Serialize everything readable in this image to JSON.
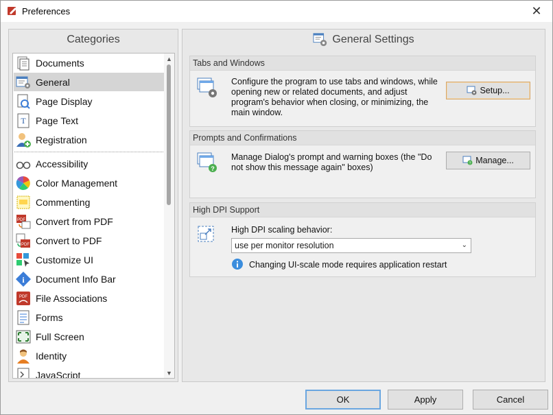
{
  "window": {
    "title": "Preferences",
    "close_glyph": "✕"
  },
  "left": {
    "header": "Categories",
    "items": [
      {
        "label": "Documents",
        "icon": "documents-icon"
      },
      {
        "label": "General",
        "icon": "general-icon",
        "selected": true
      },
      {
        "label": "Page Display",
        "icon": "page-display-icon"
      },
      {
        "label": "Page Text",
        "icon": "page-text-icon"
      },
      {
        "label": "Registration",
        "icon": "registration-icon"
      },
      {
        "label": "Accessibility",
        "icon": "accessibility-icon"
      },
      {
        "label": "Color Management",
        "icon": "color-management-icon"
      },
      {
        "label": "Commenting",
        "icon": "commenting-icon"
      },
      {
        "label": "Convert from PDF",
        "icon": "convert-from-pdf-icon"
      },
      {
        "label": "Convert to PDF",
        "icon": "convert-to-pdf-icon"
      },
      {
        "label": "Customize UI",
        "icon": "customize-ui-icon"
      },
      {
        "label": "Document Info Bar",
        "icon": "document-info-bar-icon"
      },
      {
        "label": "File Associations",
        "icon": "file-associations-icon"
      },
      {
        "label": "Forms",
        "icon": "forms-icon"
      },
      {
        "label": "Full Screen",
        "icon": "full-screen-icon"
      },
      {
        "label": "Identity",
        "icon": "identity-icon"
      },
      {
        "label": "JavaScript",
        "icon": "javascript-icon"
      }
    ]
  },
  "right": {
    "header": "General Settings",
    "tabs_windows": {
      "title": "Tabs and Windows",
      "text": "Configure the program to use tabs and windows, while opening new or related documents, and adjust program's behavior when closing, or minimizing, the main window.",
      "button": "Setup..."
    },
    "prompts": {
      "title": "Prompts and Confirmations",
      "text": "Manage Dialog's prompt and warning boxes (the \"Do not show this message again\" boxes)",
      "button": "Manage..."
    },
    "dpi": {
      "title": "High DPI Support",
      "label": "High DPI scaling behavior:",
      "selected": "use per monitor resolution",
      "info": "Changing UI-scale mode requires application restart"
    }
  },
  "footer": {
    "ok": "OK",
    "apply": "Apply",
    "cancel": "Cancel"
  },
  "colors": {
    "accent": "#6aa6e0",
    "focus_border": "#d4a66a",
    "selection": "#d5d5d5",
    "brand_red": "#c0392b"
  }
}
